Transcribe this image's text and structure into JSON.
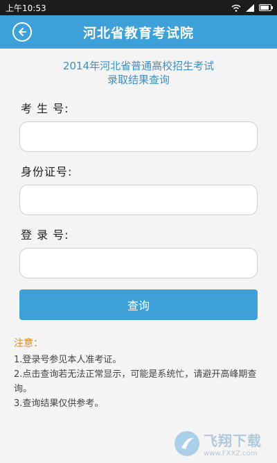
{
  "status_bar": {
    "time": "上午10:53"
  },
  "app_bar": {
    "title": "河北省教育考试院"
  },
  "subtitle": {
    "line1": "2014年河北省普通高校招生考试",
    "line2": "录取结果查询"
  },
  "form": {
    "exam_number": {
      "label": "考 生 号:",
      "value": "",
      "placeholder": ""
    },
    "id_number": {
      "label": "身份证号:",
      "value": "",
      "placeholder": ""
    },
    "login_number": {
      "label": "登 录 号:",
      "value": "",
      "placeholder": ""
    },
    "query_label": "查询"
  },
  "notes": {
    "title": "注意：",
    "items": [
      "1.登录号参见本人准考证。",
      "2.点击查询若无法正常显示，可能是系统忙，请避开高峰期查询。",
      "3.查询结果仅供参考。"
    ]
  },
  "watermark": {
    "main": "飞翔下载",
    "sub": "www.FXXZ.com"
  },
  "colors": {
    "accent": "#3ea0d9",
    "note_title": "#e08a2a",
    "subtitle": "#3f8fc7"
  },
  "icons": {
    "back": "back-arrow-icon",
    "wifi": "wifi-icon",
    "signal": "signal-icon",
    "battery": "battery-icon"
  }
}
